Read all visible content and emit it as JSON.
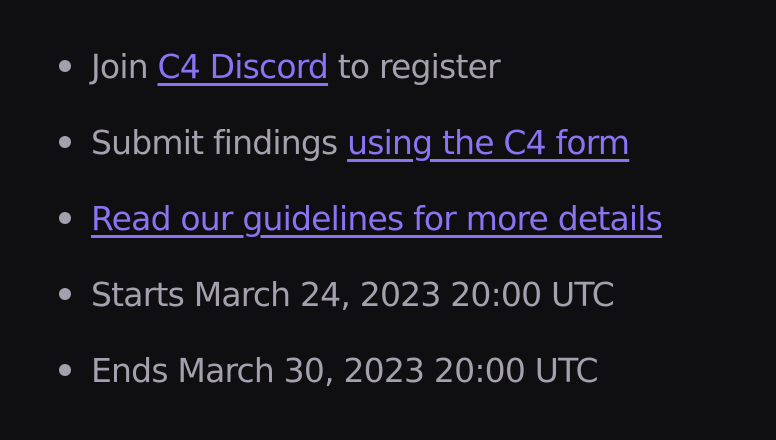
{
  "items": [
    {
      "before": "Join ",
      "link": "C4 Discord",
      "after": " to register"
    },
    {
      "before": "Submit findings ",
      "link": "using the C4 form",
      "after": ""
    },
    {
      "before": "",
      "link": "Read our guidelines for more details",
      "after": ""
    },
    {
      "text": "Starts March 24, 2023 20:00 UTC"
    },
    {
      "text": "Ends March 30, 2023 20:00 UTC"
    }
  ],
  "colors": {
    "background": "#0f0e11",
    "text": "#a4a0ad",
    "link": "#8b73f2"
  }
}
